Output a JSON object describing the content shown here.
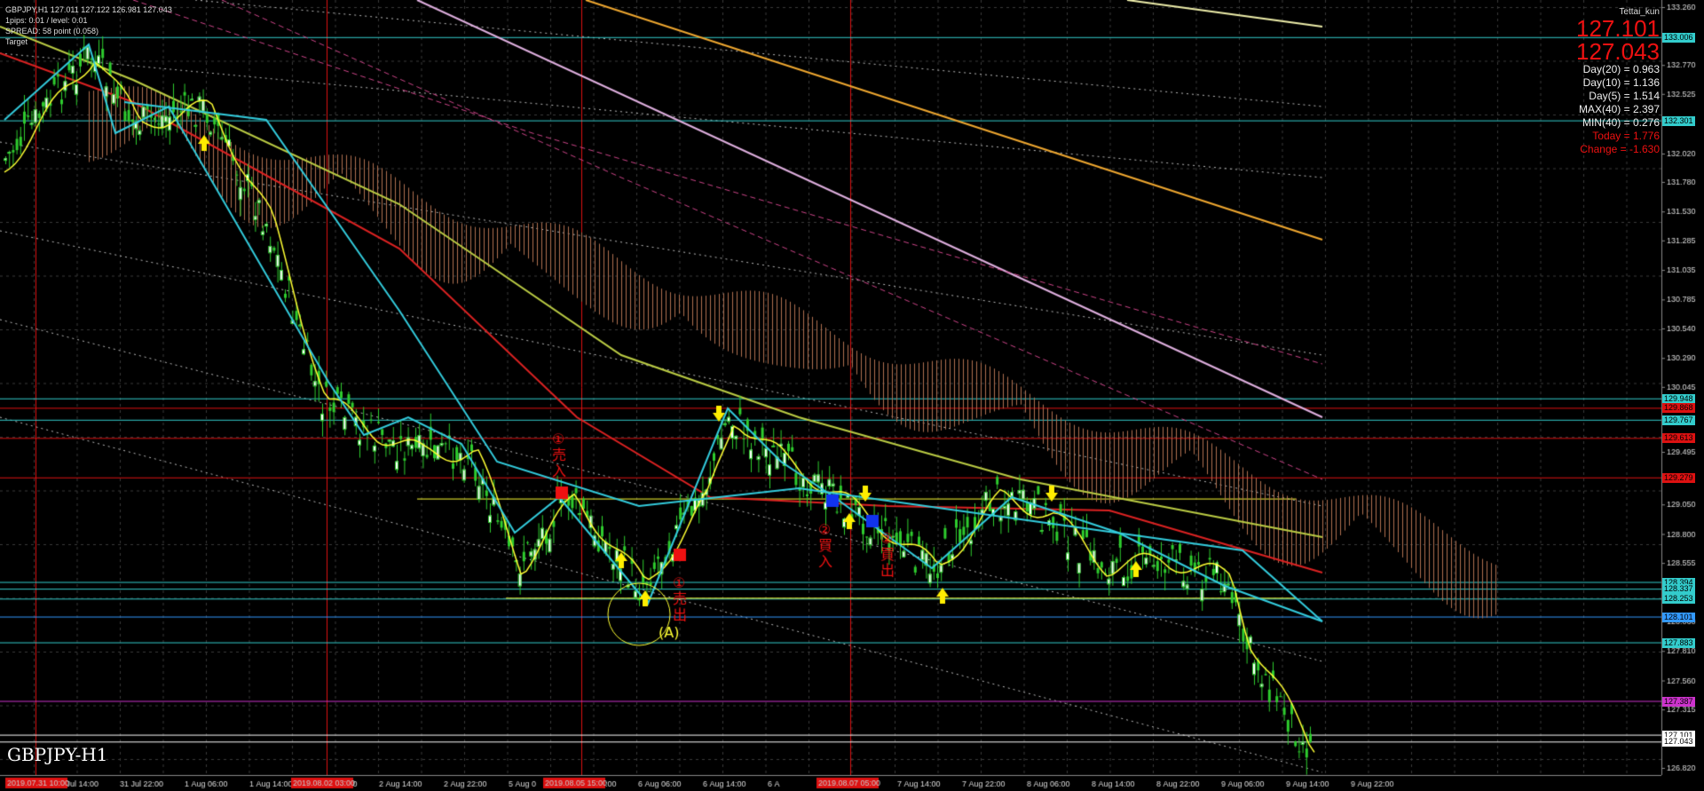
{
  "header": {
    "line1": "GBPJPY,H1  127.011 127.122 126.981 127.043",
    "line2": "1pips: 0.01 / level: 0.01",
    "line3": "SPREAD: 58 point (0.058)",
    "line4": "Target"
  },
  "symbol_title": "GBPJPY-H1",
  "info_panel": {
    "user": "Tettai_kun",
    "ask": "127.101",
    "bid": "127.043",
    "stats": [
      "Day(20) = 0.963",
      "Day(10) = 1.136",
      "Day(5) = 1.514",
      "MAX(40) = 2.397",
      "MIN(40) = 0.276"
    ],
    "today": "Today = 1.776",
    "change": "Change = -1.630"
  },
  "colors": {
    "background": "#000000",
    "grid": "#3a3a3a",
    "candle_up": "#2ecc2e",
    "fast_ma": "#ffff33",
    "zigzag": "#33ccdd",
    "ma_red": "#dd2222",
    "ma_olive": "#bbcc44",
    "ma_orange": "#f0a830",
    "ma_pink": "#e0b0e0",
    "cloud": "#b07050",
    "level_cyan": "#33cccc",
    "level_red": "#dd1111",
    "level_magenta": "#cc33cc"
  },
  "axis": {
    "price_labels": [
      "133.260",
      "132.770",
      "132.525",
      "132.020",
      "131.780",
      "131.530",
      "131.285",
      "131.035",
      "130.785",
      "130.540",
      "130.290",
      "130.045",
      "129.495",
      "129.050",
      "128.800",
      "128.555",
      "128.060",
      "127.810",
      "127.560",
      "127.315",
      "126.820"
    ],
    "time_labels": [
      "31 Jul 14:00",
      "31 Jul 22:00",
      "1 Aug 06:00",
      "1 Aug 14:00",
      "2 Aug 06:00",
      "2 Aug 14:00",
      "2 Aug 22:00",
      "5 Aug 0",
      "5 Aug 22:00",
      "6 Aug 06:00",
      "6 Aug 14:00",
      "6 A",
      "6:00",
      "7 Aug 14:00",
      "7 Aug 22:00",
      "8 Aug 06:00",
      "8 Aug 14:00",
      "8 Aug 22:00",
      "9 Aug 06:00",
      "9 Aug 14:00",
      "9 Aug 22:00"
    ],
    "time_markers": [
      "2019.07.31 10:00",
      "2019.08.02 03:00",
      "2019.08.05 15:00",
      "2019.08.07 05:00"
    ],
    "level_badges": [
      {
        "text": "133.006",
        "color": "#33cccc"
      },
      {
        "text": "132.301",
        "color": "#33cccc"
      },
      {
        "text": "129.948",
        "color": "#33cccc"
      },
      {
        "text": "129.868",
        "color": "#dd1111"
      },
      {
        "text": "129.767",
        "color": "#33cccc"
      },
      {
        "text": "129.613",
        "color": "#dd1111"
      },
      {
        "text": "129.279",
        "color": "#dd1111"
      },
      {
        "text": "128.394",
        "color": "#33cccc"
      },
      {
        "text": "128.337",
        "color": "#33cccc"
      },
      {
        "text": "128.253",
        "color": "#33cccc"
      },
      {
        "text": "128.101",
        "color": "#3399ff"
      },
      {
        "text": "127.883",
        "color": "#33cccc"
      },
      {
        "text": "127.387",
        "color": "#cc33cc"
      },
      {
        "text": "127.101",
        "color": "#ffffff"
      },
      {
        "text": "127.043",
        "color": "#ffffff"
      }
    ]
  },
  "annotations": {
    "sell_entry": "①売入",
    "sell_exit": "①売出",
    "buy_entry": "②買入",
    "buy_exit": "②買出",
    "label_a": "(A)"
  }
}
